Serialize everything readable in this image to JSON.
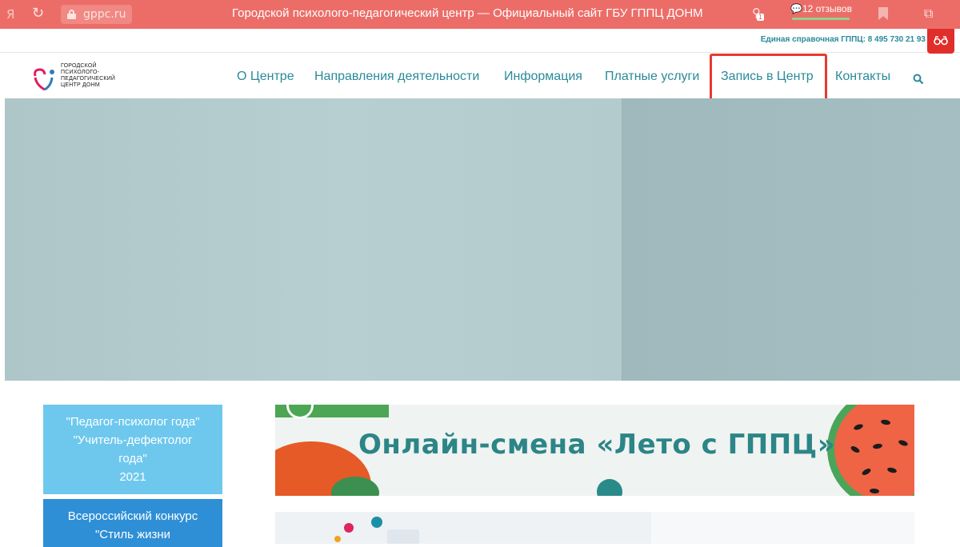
{
  "browser": {
    "ya_glyph": "Я",
    "reload_glyph": "↻",
    "url": "gppc.ru",
    "tab_title": "Городской психолого-педагогический центр — Официальный сайт ГБУ ГППЦ ДОНМ",
    "reviews": "💬12 отзывов",
    "ext_badge": "1",
    "accent": "#ec6d68"
  },
  "topbar": {
    "phone": "Единая справочная ГППЦ: 8 495 730 21 93"
  },
  "logo": {
    "line1": "ГОРОДСКОЙ",
    "line2": "ПСИХОЛОГО-",
    "line3": "ПЕДАГОГИЧЕСКИЙ",
    "line4": "ЦЕНТР ДОНМ"
  },
  "nav": {
    "items": [
      {
        "label": "О Центре"
      },
      {
        "label": "Направления деятельности"
      },
      {
        "label": "Информация"
      },
      {
        "label": "Платные услуги"
      },
      {
        "label": "Запись в Центр"
      },
      {
        "label": "Контакты"
      }
    ],
    "color": "#2a8a9a"
  },
  "sidebar": {
    "card1": {
      "l1": "\"Педагог-психолог года\"",
      "l2": "\"Учитель-дефектолог",
      "l3": "года\"",
      "l4": "2021"
    },
    "card2": {
      "l1": "Всероссийский конкурс",
      "l2": "\"Стиль жизни"
    }
  },
  "banner1": {
    "text": "Онлайн-смена «Лето с ГППЦ»"
  }
}
